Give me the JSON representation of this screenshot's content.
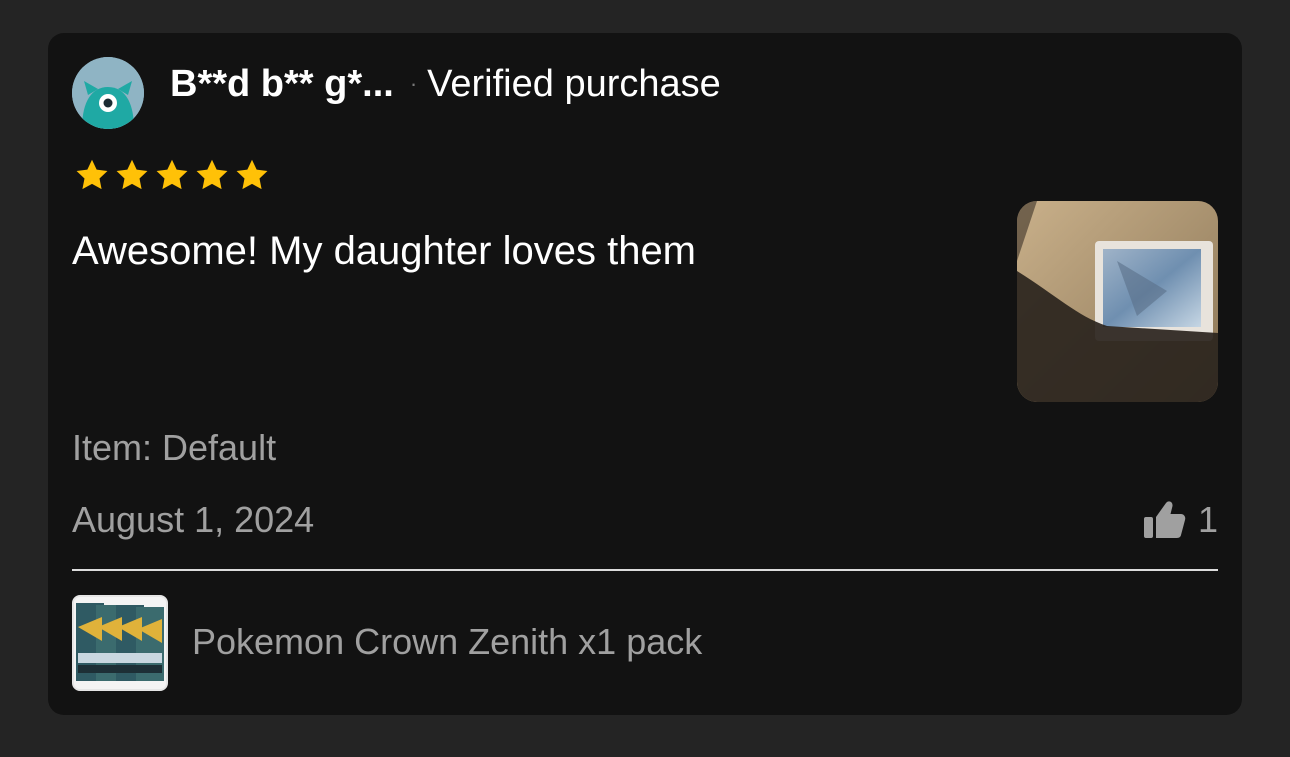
{
  "review": {
    "reviewer_name": "B**d b** g*...",
    "separator": "·",
    "verified_label": "Verified purchase",
    "avatar_icon": "monster-avatar-icon",
    "rating": 5,
    "rating_max": 5,
    "star_color": "#FFC107",
    "text": "Awesome! My daughter loves them",
    "photo_icon": "review-photo-card-sleeve",
    "item_variant": "Item: Default",
    "date": "August 1, 2024",
    "helpful_icon": "thumbs-up-icon",
    "helpful_count": "1"
  },
  "product": {
    "name": "Pokemon Crown Zenith x1 pack",
    "thumbnail_icon": "booster-packs-thumbnail"
  },
  "colors": {
    "background": "#242424",
    "card": "#121212",
    "primary_text": "#FFFFFF",
    "secondary_text": "#A0A0A0",
    "avatar_teal": "#1FA9A4"
  }
}
